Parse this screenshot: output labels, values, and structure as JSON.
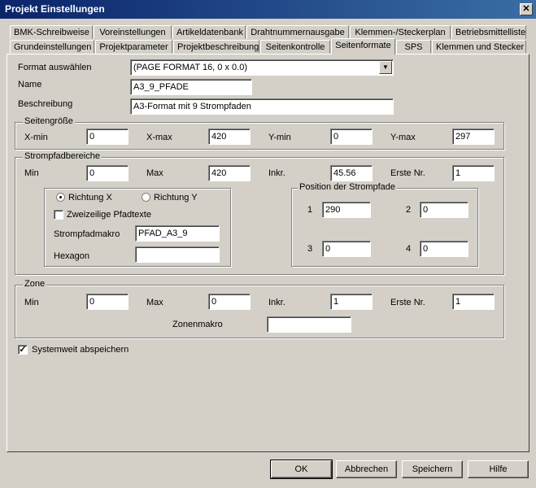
{
  "window": {
    "title": "Projekt Einstellungen",
    "close_glyph": "✕"
  },
  "tabs_row1": [
    "BMK-Schreibweise",
    "Voreinstellungen",
    "Artikeldatenbank",
    "Drahtnummernausgabe",
    "Klemmen-/Steckerplan",
    "Betriebsmittelliste"
  ],
  "tabs_row2": [
    "Grundeinstellungen",
    "Projektparameter",
    "Projektbeschreibung",
    "Seitenkontrolle",
    "Seitenformate",
    "SPS",
    "Klemmen und Stecker"
  ],
  "active_tab": "Seitenformate",
  "format": {
    "label": "Format auswählen",
    "value": "(PAGE FORMAT 16, 0 x 0.0)"
  },
  "name": {
    "label": "Name",
    "value": "A3_9_PFADE"
  },
  "beschreibung": {
    "label": "Beschreibung",
    "value": "A3-Format mit 9 Strompfaden"
  },
  "seitengroesse": {
    "title": "Seitengröße",
    "xmin_label": "X-min",
    "xmin": "0",
    "xmax_label": "X-max",
    "xmax": "420",
    "ymin_label": "Y-min",
    "ymin": "0",
    "ymax_label": "Y-max",
    "ymax": "297"
  },
  "strompfad": {
    "title": "Strompfadbereiche",
    "min_label": "Min",
    "min": "0",
    "max_label": "Max",
    "max": "420",
    "inkr_label": "Inkr.",
    "inkr": "45.56",
    "erste_label": "Erste Nr.",
    "erste": "1",
    "richtung_x": "Richtung X",
    "richtung_y": "Richtung Y",
    "zweizeilig": "Zweizeilige Pfadtexte",
    "makro_label": "Strompfadmakro",
    "makro": "PFAD_A3_9",
    "hexagon_label": "Hexagon",
    "hexagon": "",
    "position_title": "Position der Strompfade",
    "p1_label": "1",
    "p1": "290",
    "p2_label": "2",
    "p2": "0",
    "p3_label": "3",
    "p3": "0",
    "p4_label": "4",
    "p4": "0"
  },
  "zone": {
    "title": "Zone",
    "min_label": "Min",
    "min": "0",
    "max_label": "Max",
    "max": "0",
    "inkr_label": "Inkr.",
    "inkr": "1",
    "erste_label": "Erste Nr.",
    "erste": "1",
    "makro_label": "Zonenmakro",
    "makro": ""
  },
  "systemweit": {
    "label": "Systemweit abspeichern",
    "checked": true,
    "check_glyph": "✓"
  },
  "buttons": {
    "ok": "OK",
    "abbrechen": "Abbrechen",
    "speichern": "Speichern",
    "hilfe": "Hilfe"
  }
}
